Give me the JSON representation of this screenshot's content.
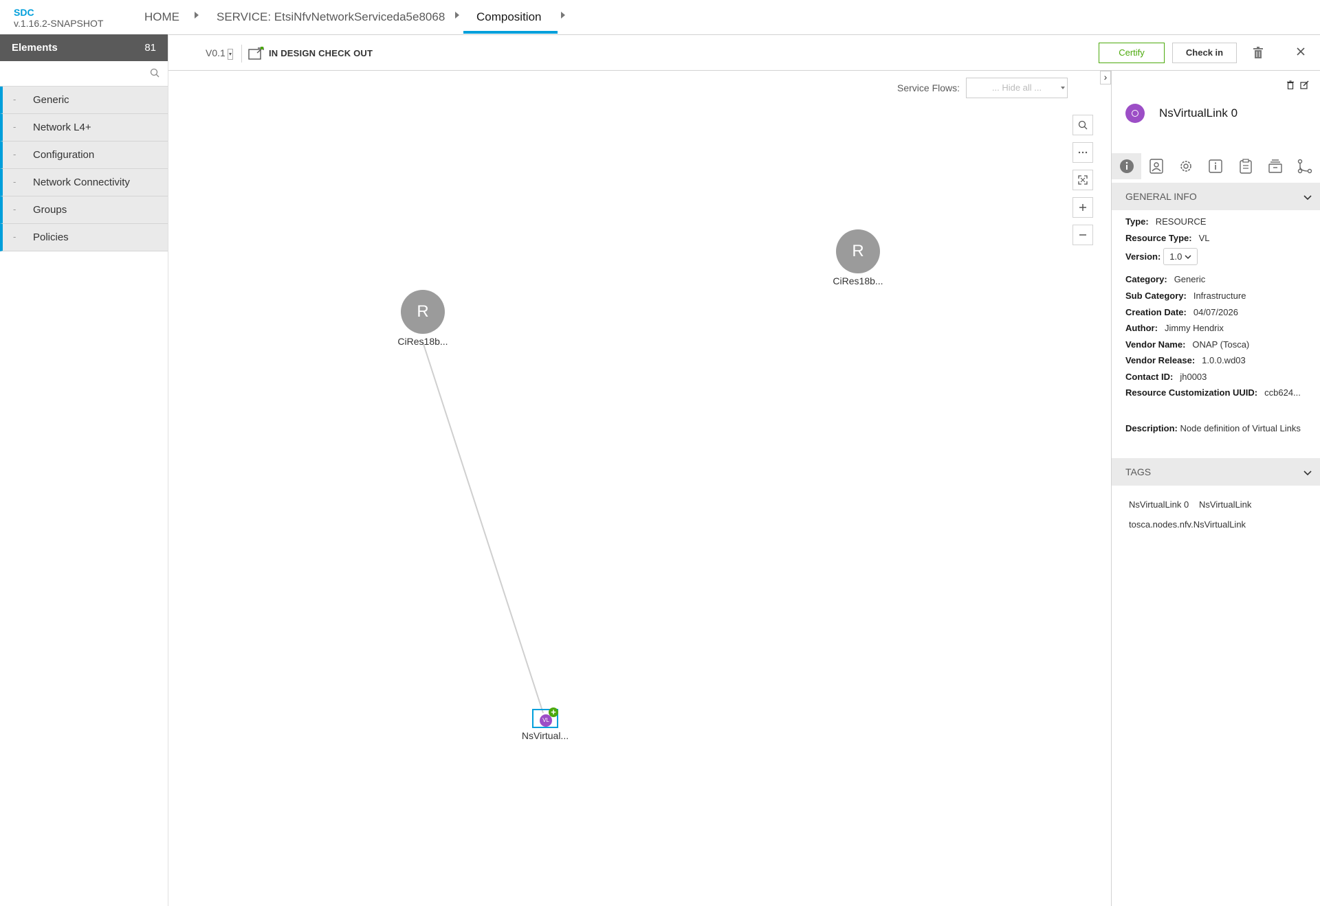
{
  "app": {
    "name": "SDC",
    "version": "v.1.16.2-SNAPSHOT"
  },
  "breadcrumb": {
    "home": "HOME",
    "service": "SERVICE: EtsiNfvNetworkServiceda5e8068",
    "current": "Composition"
  },
  "left_panel": {
    "title": "Elements",
    "count": "81",
    "search_placeholder": "",
    "categories": [
      {
        "dash": "-",
        "label": "Generic"
      },
      {
        "dash": "-",
        "label": "Network L4+"
      },
      {
        "dash": "-",
        "label": "Configuration"
      },
      {
        "dash": "-",
        "label": "Network Connectivity"
      },
      {
        "dash": "-",
        "label": "Groups"
      },
      {
        "dash": "-",
        "label": "Policies"
      }
    ]
  },
  "toolbar": {
    "version": "V0.1",
    "status": "IN DESIGN CHECK OUT",
    "certify": "Certify",
    "checkin": "Check in"
  },
  "canvas": {
    "service_flows_label": "Service Flows:",
    "service_flows_value": "... Hide all ...",
    "nodes": [
      {
        "letter": "R",
        "label": "CiRes18b..."
      },
      {
        "letter": "R",
        "label": "CiRes18b..."
      },
      {
        "letter": "VL",
        "label": "NsVirtual..."
      }
    ],
    "zoom_tools": [
      "search-icon",
      "more-icon",
      "fit-icon",
      "zoom-in-icon",
      "zoom-out-icon"
    ]
  },
  "right_panel": {
    "title": "NsVirtualLink 0",
    "general_info_title": "GENERAL INFO",
    "info": {
      "type_label": "Type:",
      "type": "RESOURCE",
      "resource_type_label": "Resource Type:",
      "resource_type": "VL",
      "version_label": "Version:",
      "version": "1.0",
      "category_label": "Category:",
      "category": "Generic",
      "sub_category_label": "Sub Category:",
      "sub_category": "Infrastructure",
      "creation_date_label": "Creation Date:",
      "creation_date": "04/07/2026",
      "author_label": "Author:",
      "author": "Jimmy Hendrix",
      "vendor_name_label": "Vendor Name:",
      "vendor_name": "ONAP (Tosca)",
      "vendor_release_label": "Vendor Release:",
      "vendor_release": "1.0.0.wd03",
      "contact_id_label": "Contact ID:",
      "contact_id": "jh0003",
      "uuid_label": "Resource Customization UUID:",
      "uuid": "ccb624...",
      "description_label": "Description:",
      "description": "Node definition of Virtual Links"
    },
    "tags_title": "TAGS",
    "tags": [
      "NsVirtualLink 0",
      "NsVirtualLink",
      "tosca.nodes.nfv.NsVirtualLink"
    ]
  },
  "colors": {
    "accent": "#009fdb",
    "certify": "#4ca90c",
    "vl_purple": "#9c4ec6",
    "node_grey": "#9b9b9b"
  }
}
